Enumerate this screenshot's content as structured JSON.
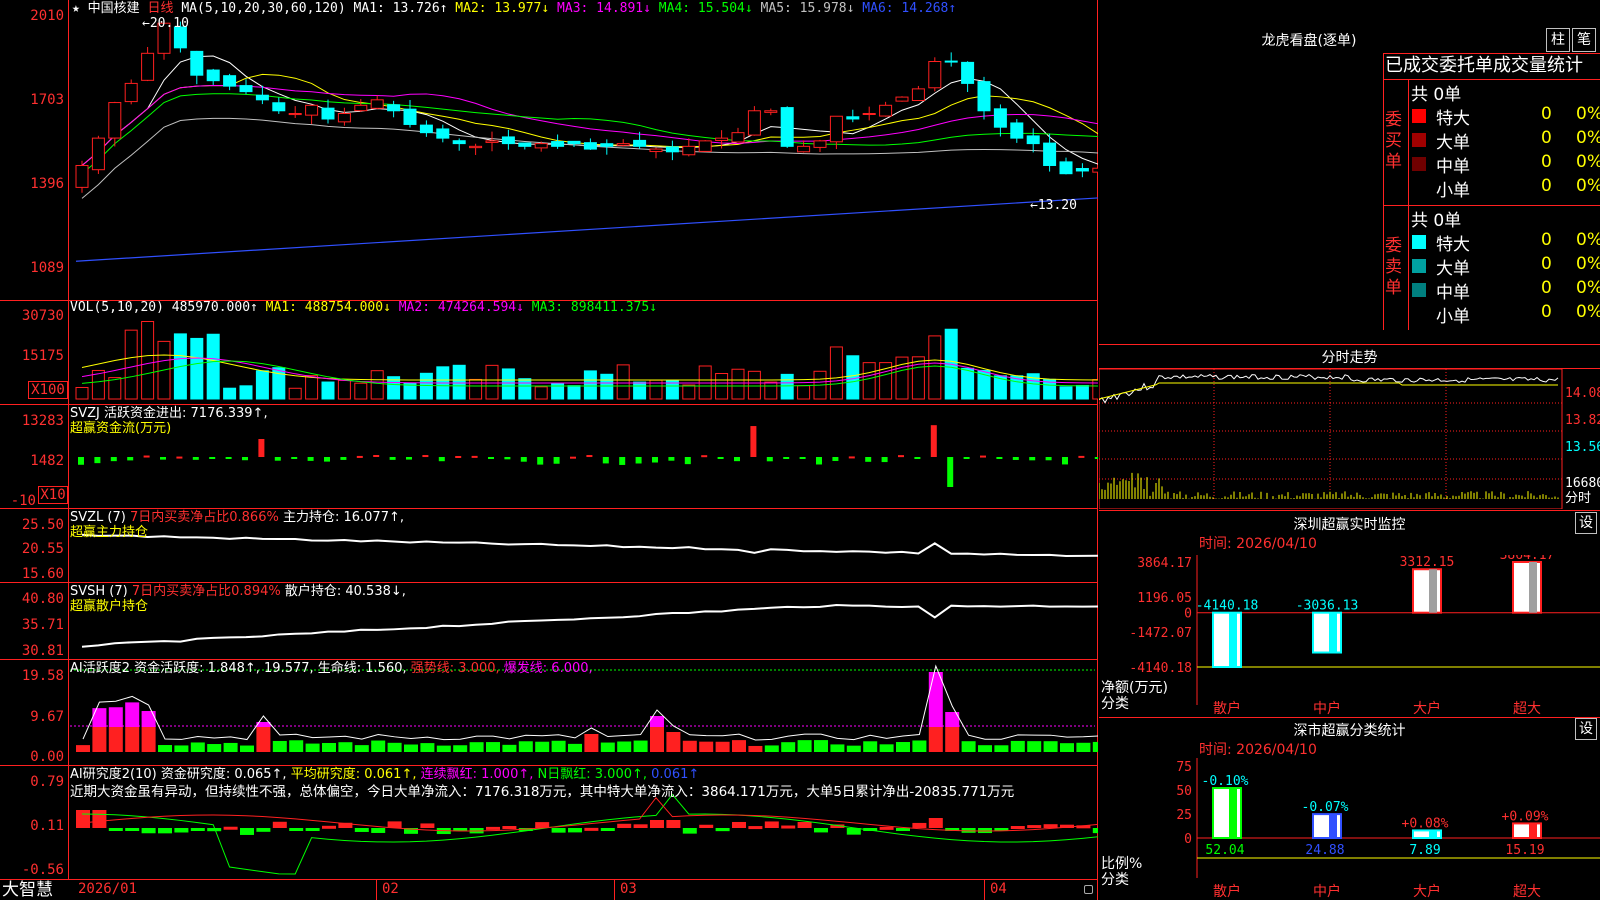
{
  "stock": {
    "name": "中国核建",
    "period": "日线",
    "star": "★"
  },
  "price_panel": {
    "ma_label": "MA(5,10,20,30,60,120)",
    "ma": [
      {
        "name": "MA1:",
        "value": "13.726↑",
        "color": "#ffffff"
      },
      {
        "name": "MA2:",
        "value": "13.977↓",
        "color": "#ffff00"
      },
      {
        "name": "MA3:",
        "value": "14.891↓",
        "color": "#ff00ff"
      },
      {
        "name": "MA4:",
        "value": "15.504↓",
        "color": "#00ff00"
      },
      {
        "name": "MA5:",
        "value": "15.978↓",
        "color": "#c0c0c0"
      },
      {
        "name": "MA6:",
        "value": "14.268↑",
        "color": "#3050ff"
      }
    ],
    "axis": [
      "2010",
      "1703",
      "1396",
      "1089"
    ],
    "high_label": "←20.10",
    "low_label": "←13.20"
  },
  "vol_panel": {
    "title": "VOL(5,10,20)",
    "value": "485970.000↑",
    "items": [
      {
        "text": "MA1: 488754.000↓",
        "color": "#ffff00"
      },
      {
        "text": "MA2: 474264.594↓",
        "color": "#ff00ff"
      },
      {
        "text": "MA3: 898411.375↓",
        "color": "#00ff00"
      }
    ],
    "axis": [
      "30730",
      "15175"
    ],
    "unit": "X100"
  },
  "svzj_panel": {
    "title": "SVZJ  活跃资金进出: 7176.339↑,",
    "subtitle": "超赢资金流(万元)",
    "axis": [
      "13283",
      "1482",
      "-10"
    ],
    "unit": "X10"
  },
  "svzl_panel": {
    "title_a": "SVZL (7)",
    "title_b": "7日内买卖净占比0.866%",
    "title_c": "主力持仓: 16.077↑,",
    "subtitle": "超赢主力持仓",
    "axis": [
      "25.50",
      "20.55",
      "15.60"
    ]
  },
  "svsh_panel": {
    "title_a": "SVSH (7)",
    "title_b": "7日内买卖净占比0.894%",
    "title_c": "散户持仓: 40.538↓,",
    "subtitle": "超赢散户持仓",
    "axis": [
      "40.80",
      "35.71",
      "30.81"
    ]
  },
  "ai_active_panel": {
    "title": "AI活跃度2 资金活跃度: 1.848↑, 19.577, 生命线: 1.560,",
    "strong": "强势线: 3.000,",
    "burst": "爆发线: 6.000,",
    "axis": [
      "19.58",
      "9.67",
      "0.00"
    ]
  },
  "ai_research_panel": {
    "title": "AI研究度2(10) 资金研究度: 0.065↑,",
    "avg": "平均研究度: 0.061↑,",
    "red": "连续飘红: 1.000↑,",
    "nred": "N日飘红: 3.000↑,",
    "last": "0.061↑",
    "comment": "近期大资金虽有异动，但持续性不强，总体偏空，今日大单净流入：7176.318万元，其中特大单净流入：3864.171万元，大单5日累计净出-20835.771万元",
    "axis": [
      "0.79",
      "0.11",
      "-0.56"
    ]
  },
  "date_axis": [
    "2026/01",
    "02",
    "03",
    "04"
  ],
  "brand": "大智慧",
  "right": {
    "title": "龙虎看盘(逐单)",
    "btn_zhu": "柱",
    "btn_bi": "笔",
    "tabs_header": "已成交委托单成交量统计",
    "buy_label": "委买单",
    "sell_label": "委卖单",
    "buy_total": "共 0单",
    "sell_total": "共 0单",
    "buy_rows": [
      {
        "name": "特大",
        "v": "0",
        "p": "0%",
        "color": "#ff0000"
      },
      {
        "name": "大单",
        "v": "0",
        "p": "0%",
        "color": "#a00000"
      },
      {
        "name": "中单",
        "v": "0",
        "p": "0%",
        "color": "#700000"
      },
      {
        "name": "小单",
        "v": "0",
        "p": "0%",
        "color": ""
      }
    ],
    "sell_rows": [
      {
        "name": "特大",
        "v": "0",
        "p": "0%",
        "color": "#00ffff"
      },
      {
        "name": "大单",
        "v": "0",
        "p": "0%",
        "color": "#00a0a0"
      },
      {
        "name": "中单",
        "v": "0",
        "p": "0%",
        "color": "#008080"
      },
      {
        "name": "小单",
        "v": "0",
        "p": "0%",
        "color": ""
      }
    ],
    "fenshi_title": "分时走势",
    "fenshi_axis": [
      "14.08",
      "13.82",
      "13.56",
      "16680",
      "分时"
    ],
    "monitor_title": "深圳超赢实时监控",
    "monitor_btn": "设",
    "monitor_time": "时间: 2026/04/10",
    "monitor_axis": [
      "3864.17",
      "1196.05",
      "0",
      "-1472.07",
      "-4140.18"
    ],
    "monitor_ylabel": "净额(万元)",
    "monitor_xlabel": "分类",
    "monitor_bars": [
      {
        "label": "散户",
        "value": "-4140.18"
      },
      {
        "label": "中户",
        "value": "-3036.13"
      },
      {
        "label": "大户",
        "value": "3312.15"
      },
      {
        "label": "超大",
        "value": "3864.17"
      }
    ],
    "stat_title": "深市超赢分类统计",
    "stat_btn": "设",
    "stat_time": "时间: 2026/04/10",
    "stat_axis": [
      "75",
      "50",
      "25",
      "0"
    ],
    "stat_ylabel": "比例%",
    "stat_xlabel": "分类",
    "stat_bars": [
      {
        "label": "散户",
        "pct": "-0.10%",
        "value": "52.04"
      },
      {
        "label": "中户",
        "pct": "-0.07%",
        "value": "24.88"
      },
      {
        "label": "大户",
        "pct": "+0.08%",
        "value": "7.89"
      },
      {
        "label": "超大",
        "pct": "+0.09%",
        "value": "15.19"
      }
    ]
  },
  "chart_data": [
    {
      "type": "candlestick",
      "title": "中国核建 日线",
      "ylim": [
        10.89,
        20.1
      ],
      "note": "daily candles approx. 2026/01 – 2026/04",
      "close": [
        14.6,
        15.6,
        16.9,
        17.6,
        18.7,
        19.8,
        18.9,
        17.9,
        17.7,
        17.5,
        17.3,
        17.0,
        16.6,
        16.5,
        16.8,
        16.3,
        16.5,
        16.8,
        17.0,
        16.6,
        16.1,
        15.8,
        15.6,
        15.4,
        15.3,
        15.5,
        15.4,
        15.3,
        15.4,
        15.3,
        15.4,
        15.2,
        15.3,
        15.4,
        15.3,
        15.2,
        15.1,
        15.3,
        15.5,
        15.6,
        15.8,
        16.6,
        16.6,
        15.3,
        15.3,
        15.5,
        16.4,
        16.3,
        16.5,
        16.8,
        17.1,
        17.4,
        18.4,
        18.4,
        17.6,
        16.6,
        16.0,
        15.6,
        15.4,
        14.6,
        14.3,
        14.4,
        14.5,
        14.6,
        14.3,
        14.2,
        14.2,
        14.3,
        14.1,
        14.1,
        14.0,
        13.6,
        13.6,
        14.1,
        14.2,
        14.1,
        14.2
      ],
      "volume_unit": "X100",
      "vol_ylim": [
        0,
        30730
      ]
    },
    {
      "type": "bar",
      "title": "深圳超赢实时监控",
      "categories": [
        "散户",
        "中户",
        "大户",
        "超大"
      ],
      "values": [
        -4140.18,
        -3036.13,
        3312.15,
        3864.17
      ],
      "ylabel": "净额(万元)",
      "xlabel": "分类",
      "ylim": [
        -4140.18,
        3864.17
      ]
    },
    {
      "type": "bar",
      "title": "深市超赢分类统计",
      "categories": [
        "散户",
        "中户",
        "大户",
        "超大"
      ],
      "values": [
        52.04,
        24.88,
        7.89,
        15.19
      ],
      "changes": [
        "-0.10%",
        "-0.07%",
        "+0.08%",
        "+0.09%"
      ],
      "ylabel": "比例%",
      "xlabel": "分类",
      "ylim": [
        0,
        75
      ]
    }
  ]
}
